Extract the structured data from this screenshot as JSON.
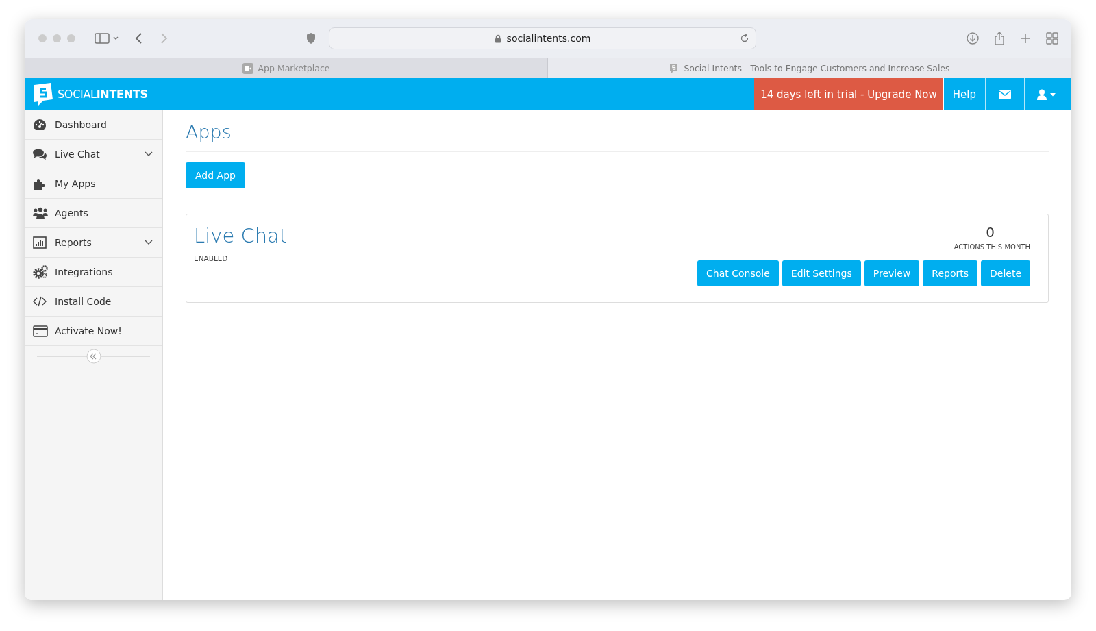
{
  "browser": {
    "address": "socialintents.com",
    "tabs": [
      {
        "label": "App Marketplace",
        "selected": false,
        "kind": "video"
      },
      {
        "label": "Social Intents - Tools to Engage Customers and Increase Sales",
        "selected": true,
        "kind": "site"
      }
    ]
  },
  "header": {
    "logo": {
      "light": "SOCIAL",
      "bold": "INTENTS"
    },
    "trial": "14 days left in trial - Upgrade Now",
    "help": "Help"
  },
  "sidebar": {
    "items": [
      {
        "label": "Dashboard",
        "kind": "dashboard",
        "expandable": false
      },
      {
        "label": "Live Chat",
        "kind": "chat",
        "expandable": true
      },
      {
        "label": "My Apps",
        "kind": "puzzle",
        "expandable": false
      },
      {
        "label": "Agents",
        "kind": "users",
        "expandable": false
      },
      {
        "label": "Reports",
        "kind": "chart",
        "expandable": true
      },
      {
        "label": "Integrations",
        "kind": "gears",
        "expandable": false
      },
      {
        "label": "Install Code",
        "kind": "code",
        "expandable": false
      },
      {
        "label": "Activate Now!",
        "kind": "card",
        "expandable": false
      }
    ]
  },
  "page": {
    "title": "Apps",
    "add_button": "Add App",
    "apps": [
      {
        "name": "Live Chat",
        "status": "ENABLED",
        "count": "0",
        "count_label": "ACTIONS THIS MONTH",
        "actions": [
          "Chat Console",
          "Edit Settings",
          "Preview",
          "Reports",
          "Delete"
        ]
      }
    ]
  }
}
